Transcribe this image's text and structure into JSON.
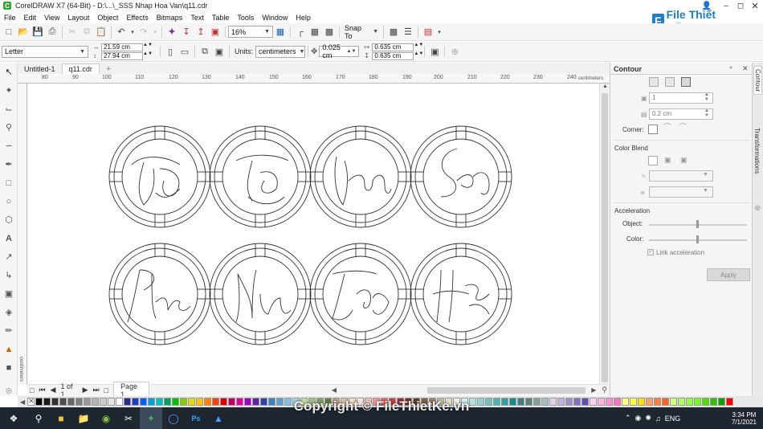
{
  "window": {
    "title": "CorelDRAW X7 (64-Bit) - D:\\...\\_SSS Nhap Hoa Van\\q11.cdr",
    "app_icon": "coreldraw-icon"
  },
  "menu": [
    "File",
    "Edit",
    "View",
    "Layout",
    "Object",
    "Effects",
    "Bitmaps",
    "Text",
    "Table",
    "Tools",
    "Window",
    "Help"
  ],
  "standard_toolbar": {
    "zoom": "16%",
    "snap_to": "Snap To"
  },
  "property_bar": {
    "page_size": "Letter",
    "width": "21.59 cm",
    "height": "27.94 cm",
    "units_label": "Units:",
    "units": "centimeters",
    "nudge": "0.025 cm",
    "dup_x": "0.635 cm",
    "dup_y": "0.635 cm"
  },
  "doc_tabs": [
    {
      "label": "Untitled-1"
    },
    {
      "label": "q11.cdr"
    }
  ],
  "ruler": {
    "h_labels": [
      "80",
      "90",
      "100",
      "110",
      "120",
      "130",
      "140",
      "150",
      "160",
      "170",
      "180",
      "190",
      "200",
      "210",
      "220",
      "230",
      "240"
    ],
    "h_unit": "centimeters",
    "v_unit": "centimeters"
  },
  "page_nav": {
    "counter": "1 of 1",
    "page_tab": "Page 1"
  },
  "docker": {
    "title": "Contour",
    "steps": "1",
    "offset": "0.2 cm",
    "corner_label": "Corner:",
    "color_blend_label": "Color Blend",
    "acceleration_label": "Acceleration",
    "object_label": "Object:",
    "color_label": "Color:",
    "link_acceleration": "Link acceleration",
    "apply": "Apply",
    "tabs": [
      "Contour",
      "Transformations"
    ]
  },
  "palette_colors": [
    "#000000",
    "#1a1a1a",
    "#333333",
    "#4d4d4d",
    "#666666",
    "#808080",
    "#999999",
    "#b3b3b3",
    "#cccccc",
    "#e6e6e6",
    "#ffffff",
    "#2b2b8a",
    "#1f3fbf",
    "#0060ff",
    "#00a0e0",
    "#00c0c0",
    "#00a060",
    "#00c000",
    "#80d000",
    "#e0e000",
    "#ffc000",
    "#ff8000",
    "#ff4000",
    "#e00000",
    "#c00060",
    "#e000a0",
    "#a000c0",
    "#6020a0",
    "#3040b0",
    "#4080c0",
    "#60a0d0",
    "#80c0e0",
    "#a0d8f0",
    "#c0e0a0",
    "#a0c080",
    "#80a060",
    "#608040",
    "#c0a080",
    "#e0c0a0",
    "#f0e0c0",
    "#ffe0e0",
    "#ffc0c0",
    "#ff9090",
    "#ff6060",
    "#d04040",
    "#a03030",
    "#803020",
    "#604020",
    "#806040",
    "#a08060",
    "#c0c0a0",
    "#e0e0c0",
    "#f0f0e0",
    "#d0f0f0",
    "#b0e0e0",
    "#90d0d0",
    "#70c0c0",
    "#50b0b0",
    "#30a0a0",
    "#109090",
    "#408080",
    "#608080",
    "#80a0a0",
    "#a0c0c0",
    "#e0d0f0",
    "#c0b0e0",
    "#a090d0",
    "#8070c0",
    "#6050b0",
    "#ffd0f0",
    "#ffb0e0",
    "#ff90d0",
    "#ff70c0",
    "#ffff80",
    "#ffff40",
    "#ffe000",
    "#ffa060",
    "#ff8040",
    "#ff6020",
    "#d0ff80",
    "#b0ff60",
    "#90ff40",
    "#70ff20",
    "#50e000",
    "#30c000",
    "#10a000",
    "#ff0000"
  ],
  "taskbar": {
    "time": "3:34 PM",
    "date": "7/1/2021",
    "language": "ENG"
  },
  "watermark": {
    "top_brand": "File Thiết Kế.vn",
    "bottom": "Copyright © FileThietKe.vn"
  }
}
